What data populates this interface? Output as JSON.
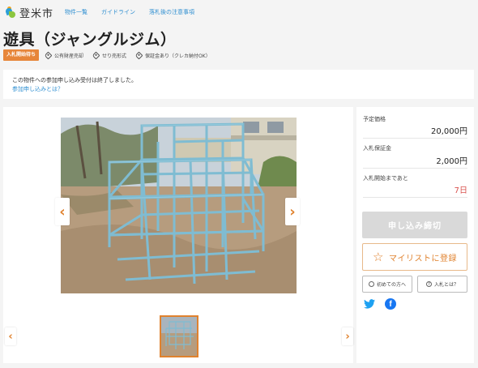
{
  "header": {
    "city": "登米市",
    "nav": [
      "物件一覧",
      "ガイドライン",
      "落札後の注意事項"
    ]
  },
  "item": {
    "title": "遊具（ジャングルジム）",
    "status": "入札開始待ち",
    "tags": [
      "公有財産売却",
      "せり売形式",
      "保証金あり（クレカ納付OK）"
    ]
  },
  "notice": {
    "text": "この物件への参加申し込み受付は終了しました。",
    "link": "参加申し込みとは？"
  },
  "side": {
    "price_label": "予定価格",
    "price_value": "20,000円",
    "deposit_label": "入札保証金",
    "deposit_value": "2,000円",
    "until_label": "入札開始まであと",
    "until_value": "7日",
    "closed_button": "申し込み締切",
    "mylist_button": "マイリストに登録",
    "first_time_button": "初めての方へ",
    "about_bid_button": "入札とは？"
  },
  "icons": {
    "twitter": "twitter-icon",
    "facebook": "facebook-icon",
    "arrow_left": "‹",
    "arrow_right": "›",
    "star": "☆"
  },
  "colors": {
    "accent": "#e0822e",
    "link": "#2f8fd1",
    "frame": "#7fbcd2",
    "red": "#d9534f",
    "twitter": "#1da1f2",
    "facebook": "#1877f2"
  }
}
